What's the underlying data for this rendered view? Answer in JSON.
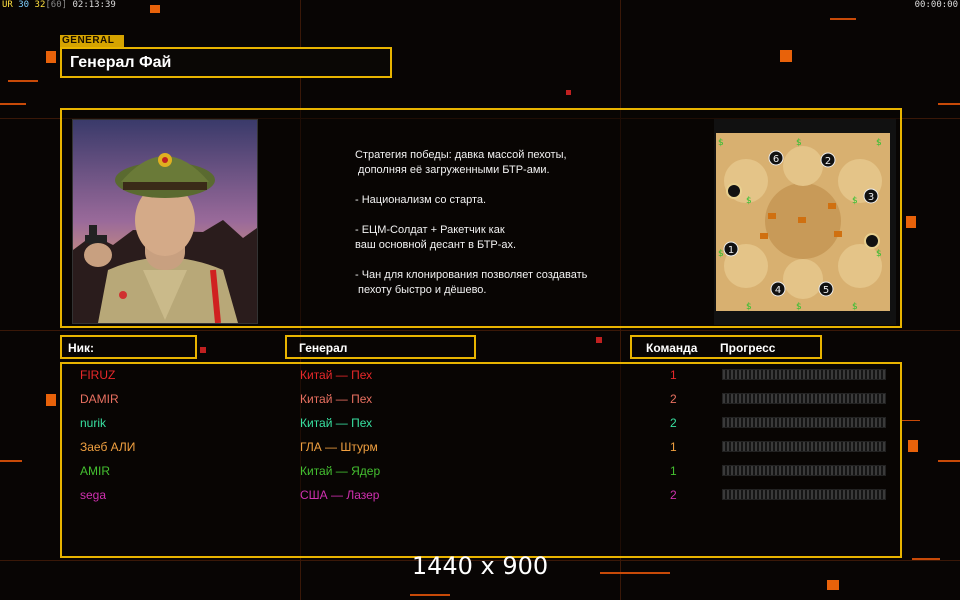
{
  "hud": {
    "ur": "UR",
    "fps1": "30",
    "fps2": "32",
    "fps_cap": "[60]",
    "clock": "02:13:39",
    "timer": "00:00:00"
  },
  "general": {
    "tag": "GENERAL",
    "name": "Генерал Фай",
    "description": [
      "Стратегия победы: давка массой пехоты,",
      " дополняя её загруженными БТР-ами.",
      "",
      "- Национализм со старта.",
      "",
      "- ЕЦМ-Солдат + Ракетчик как",
      "ваш основной десант в БТР-ах.",
      "",
      "- Чан для клонирования позволяет создавать",
      " пехоту быстро и дёшево."
    ]
  },
  "map": {
    "start_positions": [
      "1",
      "2",
      "3",
      "4",
      "5",
      "6"
    ]
  },
  "table": {
    "headers": {
      "nick": "Ник:",
      "general": "Генерал",
      "team": "Команда",
      "progress": "Прогресс"
    },
    "rows": [
      {
        "nick": "FIRUZ",
        "general": "Китай — Пех",
        "team": "1",
        "color": "#e8282a",
        "progress": 0
      },
      {
        "nick": "DAMIR",
        "general": "Китай — Пех",
        "team": "2",
        "color": "#e87060",
        "progress": 0
      },
      {
        "nick": "nurik",
        "general": "Китай — Пех",
        "team": "2",
        "color": "#38e0a0",
        "progress": 0
      },
      {
        "nick": "Заеб АЛИ",
        "general": "ГЛА — Штурм",
        "team": "1",
        "color": "#f0a040",
        "progress": 0
      },
      {
        "nick": "AMIR",
        "general": "Китай — Ядер",
        "team": "1",
        "color": "#44c030",
        "progress": 0
      },
      {
        "nick": "sega",
        "general": "США — Лазер",
        "team": "2",
        "color": "#d030b0",
        "progress": 0
      }
    ]
  },
  "resolution": "1440 x 900",
  "colors": {
    "accent": "#e8b400",
    "orange": "#e8620a"
  }
}
